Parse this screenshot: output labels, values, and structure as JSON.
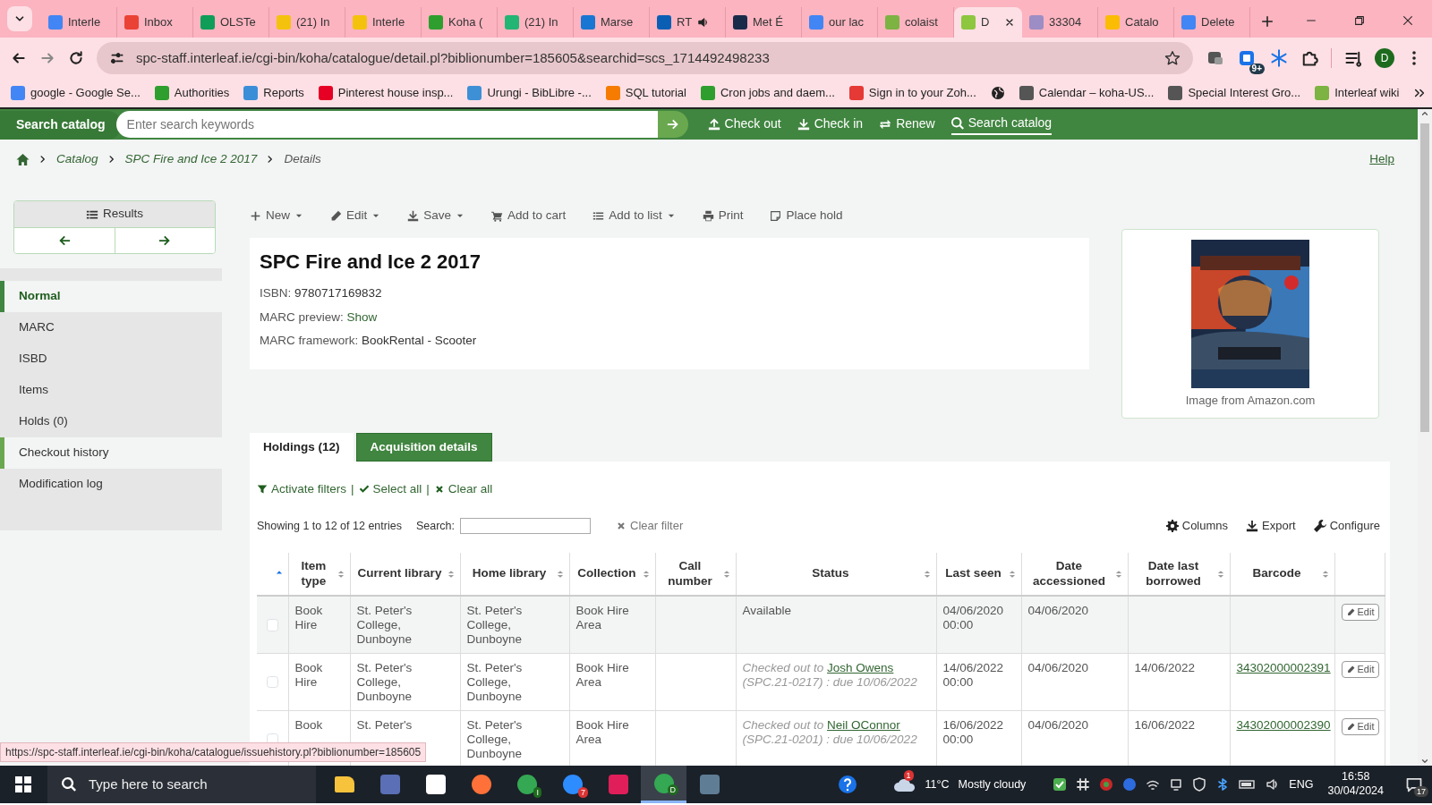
{
  "browser": {
    "tabs": [
      {
        "title": "Interle",
        "color": "#4285f4",
        "selected": false,
        "audio": false
      },
      {
        "title": "Inbox",
        "color": "#ea4335",
        "selected": false,
        "audio": false
      },
      {
        "title": "OLSTe",
        "color": "#0f9d58",
        "selected": false,
        "audio": false
      },
      {
        "title": "(21) In",
        "color": "#f4c20d",
        "selected": false,
        "audio": false
      },
      {
        "title": "Interle",
        "color": "#f4c20d",
        "selected": false,
        "audio": false
      },
      {
        "title": "Koha (",
        "color": "#2e9e2e",
        "selected": false,
        "audio": false
      },
      {
        "title": "(21) In",
        "color": "#22b573",
        "selected": false,
        "audio": false
      },
      {
        "title": "Marse",
        "color": "#1976d2",
        "selected": false,
        "audio": false
      },
      {
        "title": "RT",
        "color": "#0a5fb4",
        "selected": false,
        "audio": true
      },
      {
        "title": "Met É",
        "color": "#1a2b4a",
        "selected": false,
        "audio": false
      },
      {
        "title": "our lac",
        "color": "#4285f4",
        "selected": false,
        "audio": false
      },
      {
        "title": "colaist",
        "color": "#7cb342",
        "selected": false,
        "audio": false
      },
      {
        "title": "D",
        "color": "#8dc63f",
        "selected": true,
        "audio": false
      },
      {
        "title": "33304",
        "color": "#9c8dc4",
        "selected": false,
        "audio": false
      },
      {
        "title": "Catalo",
        "color": "#fbbc04",
        "selected": false,
        "audio": false
      },
      {
        "title": "Delete",
        "color": "#4285f4",
        "selected": false,
        "audio": false
      }
    ],
    "address": "spc-staff.interleaf.ie/cgi-bin/koha/catalogue/detail.pl?biblionumber=185605&searchid=scs_1714492498233",
    "extension_badge": "9+",
    "profile": "D",
    "bookmarks": [
      {
        "kind": "site",
        "title": "google - Google Se...",
        "color": "#4285f4"
      },
      {
        "kind": "site",
        "title": "Authorities",
        "color": "#2e9e2e"
      },
      {
        "kind": "site",
        "title": "Reports",
        "color": "#3a8ed8"
      },
      {
        "kind": "site",
        "title": "Pinterest house insp...",
        "color": "#e60023"
      },
      {
        "kind": "site",
        "title": "Urungi - BibLibre -...",
        "color": "#3d8fd6"
      },
      {
        "kind": "site",
        "title": "SQL tutorial",
        "color": "#f57c00"
      },
      {
        "kind": "site",
        "title": "Cron jobs and daem...",
        "color": "#2e9e2e"
      },
      {
        "kind": "site",
        "title": "Sign in to your Zoh...",
        "color": "#e53935"
      },
      {
        "kind": "globe"
      },
      {
        "kind": "site",
        "title": "Calendar – koha-US...",
        "color": "#555555"
      },
      {
        "kind": "site",
        "title": "Special Interest Gro...",
        "color": "#555555"
      },
      {
        "kind": "site",
        "title": "Interleaf wiki",
        "color": "#7cb342"
      }
    ]
  },
  "koha": {
    "header": {
      "search_label": "Search catalog",
      "placeholder": "Enter search keywords",
      "links": [
        {
          "label": "Check out",
          "selected": false
        },
        {
          "label": "Check in",
          "selected": false
        },
        {
          "label": "Renew",
          "selected": false
        },
        {
          "label": "Search catalog",
          "selected": true
        }
      ]
    },
    "breadcrumb": [
      {
        "label": "Catalog",
        "link": true
      },
      {
        "label": "SPC Fire and Ice 2 2017",
        "link": true
      },
      {
        "label": "Details",
        "link": false
      }
    ],
    "help": "Help",
    "results_nav": {
      "label": "Results"
    },
    "sidebar": [
      {
        "label": "Normal",
        "selected": true,
        "hovered": false
      },
      {
        "label": "MARC",
        "selected": false,
        "hovered": false
      },
      {
        "label": "ISBD",
        "selected": false,
        "hovered": false
      },
      {
        "label": "Items",
        "selected": false,
        "hovered": false
      },
      {
        "label": "Holds (0)",
        "selected": false,
        "hovered": false
      },
      {
        "label": "Checkout history",
        "selected": false,
        "hovered": true
      },
      {
        "label": "Modification log",
        "selected": false,
        "hovered": false
      }
    ],
    "toolbar": [
      {
        "label": "New",
        "dropdown": true
      },
      {
        "label": "Edit",
        "dropdown": true
      },
      {
        "label": "Save",
        "dropdown": true
      },
      {
        "label": "Add to cart",
        "dropdown": false
      },
      {
        "label": "Add to list",
        "dropdown": true
      },
      {
        "label": "Print",
        "dropdown": false
      },
      {
        "label": "Place hold",
        "dropdown": false
      }
    ],
    "record": {
      "title": "SPC Fire and Ice 2 2017",
      "fields": [
        {
          "label": "ISBN:",
          "value": "9780717169832",
          "kind": "text"
        },
        {
          "label": "MARC preview:",
          "value": "Show",
          "kind": "link"
        },
        {
          "label": "MARC framework:",
          "value": "BookRental - Scooter",
          "kind": "text"
        }
      ]
    },
    "cover": {
      "kind": "picture",
      "caption": "Image from Amazon.com"
    },
    "holdings": {
      "tabs": [
        {
          "label": "Holdings (12)",
          "selected": true
        },
        {
          "label": "Acquisition details",
          "selected": false
        }
      ],
      "filter_links": [
        {
          "kind": "link",
          "label": "Activate filters"
        },
        {
          "kind": "separator",
          "label": "|"
        },
        {
          "kind": "link",
          "label": "Select all"
        },
        {
          "kind": "separator",
          "label": "|"
        },
        {
          "kind": "link",
          "label": "Clear all"
        }
      ],
      "info": "Showing 1 to 12 of 12 entries",
      "search_label": "Search:",
      "clear_filter": "Clear filter",
      "tools": [
        {
          "label": "Columns"
        },
        {
          "label": "Export"
        },
        {
          "label": "Configure"
        }
      ],
      "columns": [
        {
          "kind": "select",
          "sorted_ascending": true
        },
        {
          "kind": "data",
          "label": "Item type",
          "sorted_ascending": false
        },
        {
          "kind": "data",
          "label": "Current library",
          "sorted_ascending": false
        },
        {
          "kind": "data",
          "label": "Home library",
          "sorted_ascending": false
        },
        {
          "kind": "data",
          "label": "Collection",
          "sorted_ascending": false
        },
        {
          "kind": "data",
          "label": "Call number",
          "sorted_ascending": false
        },
        {
          "kind": "data",
          "label": "Status",
          "sorted_ascending": false
        },
        {
          "kind": "data",
          "label": "Last seen",
          "sorted_ascending": false
        },
        {
          "kind": "data",
          "label": "Date accessioned",
          "sorted_ascending": false
        },
        {
          "kind": "data",
          "label": "Date last borrowed",
          "sorted_ascending": false
        },
        {
          "kind": "data",
          "label": "Barcode",
          "sorted_ascending": false
        },
        {
          "kind": "actions"
        }
      ],
      "rows": [
        {
          "checked": false,
          "highlighted": true,
          "item_type": "Book Hire",
          "current_library": "St. Peter's College, Dunboyne",
          "home_library": "St. Peter's College, Dunboyne",
          "collection": "Book Hire Area",
          "status": {
            "kind": "available",
            "text": "Available"
          },
          "last_seen": "04/06/2020 00:00",
          "date_accessioned": "04/06/2020",
          "edit": "Edit"
        },
        {
          "checked": false,
          "highlighted": false,
          "item_type": "Book Hire",
          "current_library": "St. Peter's College, Dunboyne",
          "home_library": "St. Peter's College, Dunboyne",
          "collection": "Book Hire Area",
          "status": {
            "kind": "checked_out",
            "prefix": "Checked out to",
            "patron": "Josh Owens",
            "suffix": "(SPC.21-0217) : due 10/06/2022"
          },
          "last_seen": "14/06/2022 00:00",
          "date_accessioned": "04/06/2020",
          "date_last_borrowed": "14/06/2022",
          "barcode": "34302000002391",
          "edit": "Edit"
        },
        {
          "checked": false,
          "highlighted": false,
          "item_type": "Book",
          "current_library": "St. Peter's",
          "home_library": "St. Peter's College, Dunboyne",
          "collection": "Book Hire Area",
          "status": {
            "kind": "checked_out",
            "prefix": "Checked out to",
            "patron": "Neil OConnor",
            "suffix": "(SPC.21-0201) : due 10/06/2022"
          },
          "last_seen": "16/06/2022 00:00",
          "date_accessioned": "04/06/2020",
          "date_last_borrowed": "16/06/2022",
          "barcode": "34302000002390",
          "edit": "Edit"
        }
      ]
    }
  },
  "status_url": "https://spc-staff.interleaf.ie/cgi-bin/koha/catalogue/issuehistory.pl?biblionumber=185605",
  "taskbar": {
    "search_placeholder": "Type here to search",
    "apps": [
      {
        "kind": "folder",
        "color": "#f8c33c",
        "active": false
      },
      {
        "kind": "tile",
        "color": "#5a6fb5",
        "active": false
      },
      {
        "kind": "tile",
        "color": "#ffffff",
        "active": false
      },
      {
        "kind": "round",
        "color": "#ff7139",
        "active": false
      },
      {
        "kind": "round",
        "color": "#34a853",
        "label": "I",
        "active": false
      },
      {
        "kind": "round",
        "color": "#2d8cff",
        "badge": "7",
        "active": false
      },
      {
        "kind": "tile",
        "color": "#e01e5a",
        "active": false
      },
      {
        "kind": "round",
        "color": "#34a853",
        "label": "D",
        "active": true
      },
      {
        "kind": "tile",
        "color": "#5f7d95",
        "active": false
      }
    ],
    "weather": {
      "badge": "1",
      "temperature": "11°C",
      "condition": "Mostly cloudy"
    },
    "language": "ENG",
    "time": "16:58",
    "date": "30/04/2024",
    "notifications": "17"
  }
}
